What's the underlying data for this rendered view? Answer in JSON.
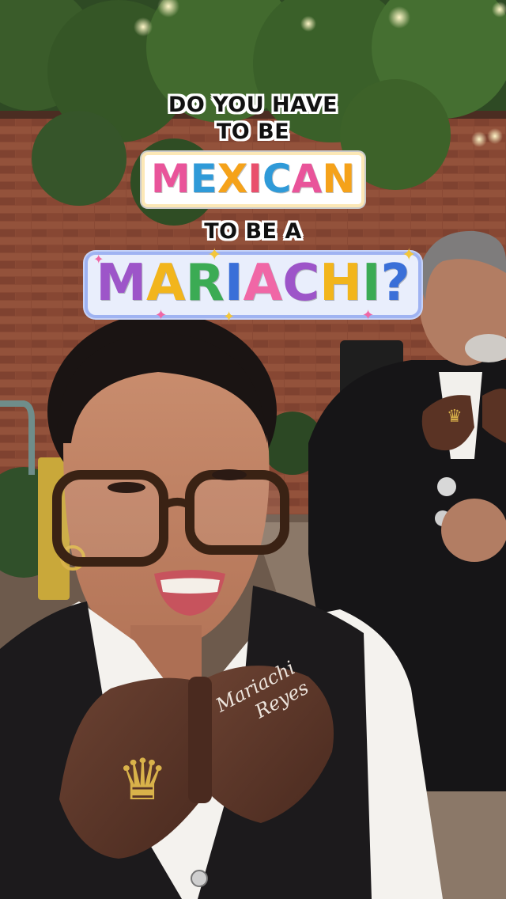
{
  "caption": {
    "line1": "DO YOU HAVE",
    "line2": "TO BE",
    "line3": "TO BE A"
  },
  "word_mexican": [
    "M",
    "E",
    "X",
    "I",
    "C",
    "A",
    "N"
  ],
  "word_mexican_colors": [
    "#e9549a",
    "#2f9ad8",
    "#f5a21a",
    "#e94f6c",
    "#2f9ad8",
    "#e9549a",
    "#f5a21a"
  ],
  "word_mariachi": [
    "M",
    "A",
    "R",
    "I",
    "A",
    "C",
    "H",
    "I",
    "?"
  ],
  "word_mariachi_colors": [
    "#9d55c9",
    "#f2b51c",
    "#3bab54",
    "#3a6fd8",
    "#f067a6",
    "#9d55c9",
    "#f2b51c",
    "#3bab54",
    "#3a6fd8"
  ],
  "bow_text": {
    "line1": "Mariachi",
    "line2": "Reyes"
  },
  "colors": {
    "brick": "#8a4a35",
    "vest": "#1c1a1c",
    "bow": "#5a3527",
    "gold": "#d9b24a"
  }
}
